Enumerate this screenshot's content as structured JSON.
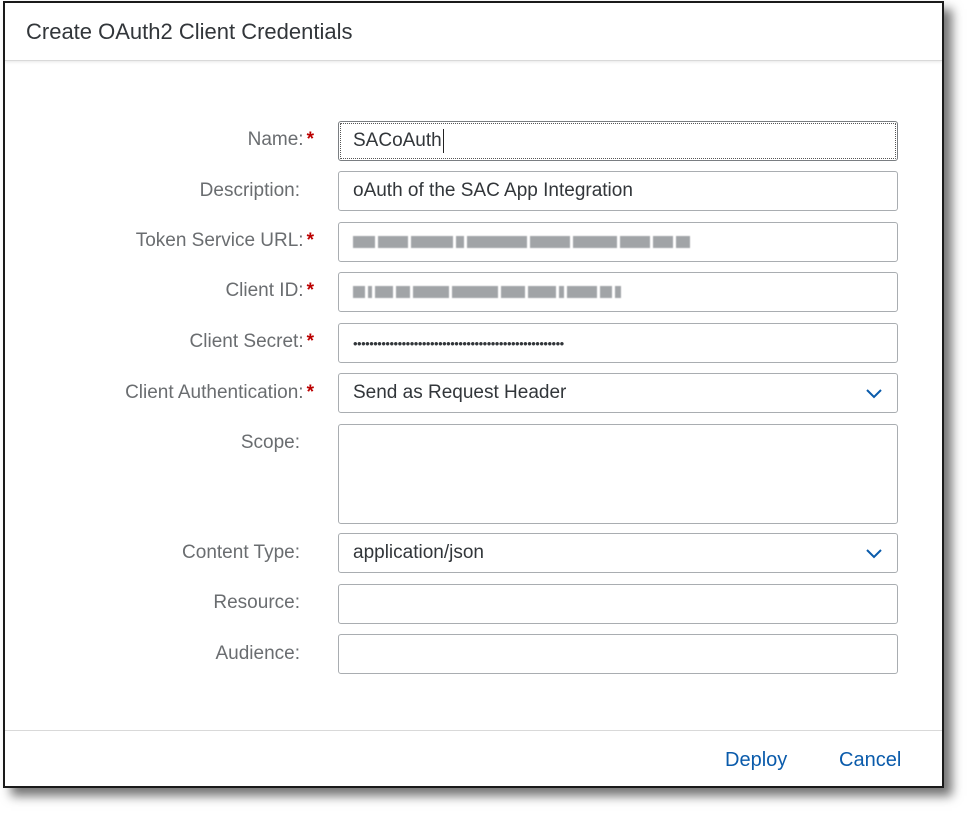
{
  "dialog": {
    "title": "Create OAuth2 Client Credentials"
  },
  "form": {
    "name": {
      "label": "Name:",
      "value": "SACoAuth"
    },
    "description": {
      "label": "Description:",
      "value": "oAuth of the SAC App Integration"
    },
    "token_service_url": {
      "label": "Token Service URL:"
    },
    "client_id": {
      "label": "Client ID:"
    },
    "client_secret": {
      "label": "Client Secret:",
      "value": "••••••••••••••••••••••••••••••••••••••••••••••••••••"
    },
    "client_authentication": {
      "label": "Client Authentication:",
      "value": "Send as Request Header"
    },
    "scope": {
      "label": "Scope:",
      "value": ""
    },
    "content_type": {
      "label": "Content Type:",
      "value": "application/json"
    },
    "resource": {
      "label": "Resource:",
      "value": ""
    },
    "audience": {
      "label": "Audience:",
      "value": ""
    },
    "required_marker": "*"
  },
  "footer": {
    "deploy_label": "Deploy",
    "cancel_label": "Cancel"
  },
  "colors": {
    "accent": "#0a5bab",
    "required": "#bb0000",
    "label": "#6a6d70",
    "text": "#32363a",
    "border": "#a9adb1"
  }
}
